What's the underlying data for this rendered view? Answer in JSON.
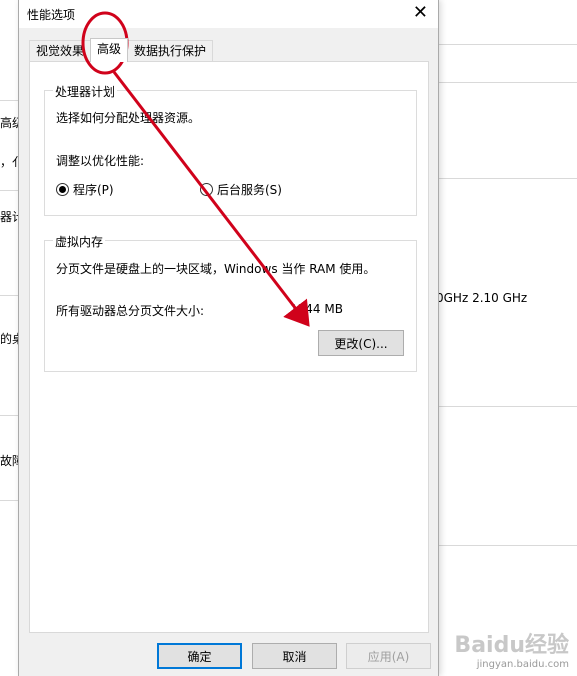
{
  "dialog": {
    "title": "性能选项",
    "close_symbol": "✕",
    "tabs": [
      {
        "label": "视觉效果"
      },
      {
        "label": "高级"
      },
      {
        "label": "数据执行保护"
      }
    ],
    "processor_group": {
      "title": "处理器计划",
      "description": "选择如何分配处理器资源。",
      "optimize_label": "调整以优化性能:",
      "option_programs": "程序(P)",
      "option_background": "后台服务(S)",
      "selected": "programs"
    },
    "virtual_memory_group": {
      "title": "虚拟内存",
      "description": "分页文件是硬盘上的一块区域，Windows 当作 RAM 使用。",
      "total_label": "所有驱动器总分页文件大小:",
      "total_value": "1344 MB",
      "change_button": "更改(C)..."
    },
    "buttons": {
      "ok": "确定",
      "cancel": "取消",
      "apply": "应用(A)"
    }
  },
  "background_window": {
    "left_fragments": [
      "高级",
      "，亻",
      "器计",
      "的桌",
      "故障"
    ],
    "cpu_speed": "0GHz   2.10 GHz"
  },
  "watermark": {
    "brand": "Baidu经验",
    "url": "jingyan.baidu.com"
  },
  "annotation_color": "#d0021b"
}
